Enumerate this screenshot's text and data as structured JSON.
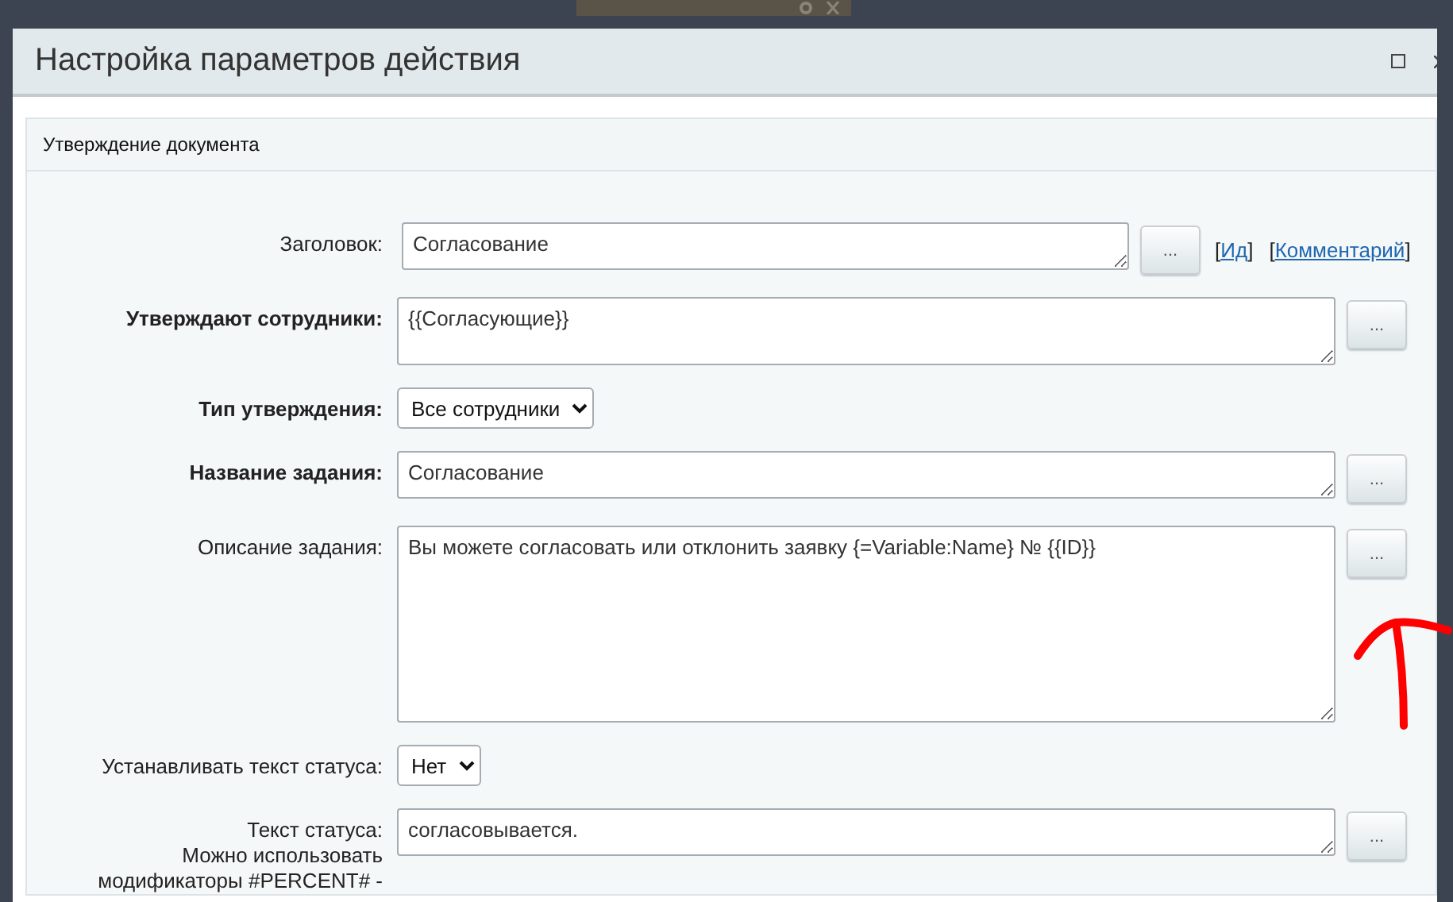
{
  "dialog": {
    "title": "Настройка параметров действия"
  },
  "section": {
    "title": "Утверждение документа"
  },
  "fields": [
    {
      "kind": "input",
      "label": "Заголовок:",
      "required": false,
      "value": "Согласование",
      "button": "...",
      "links": [
        {
          "before": "[",
          "text": "Ид",
          "after": "]"
        },
        {
          "before": "[",
          "text": "Комментарий",
          "after": "]"
        }
      ]
    },
    {
      "kind": "textarea",
      "label": "Утверждают сотрудники:",
      "required": true,
      "value": "{{Согласующие}}",
      "button": "..."
    },
    {
      "kind": "select",
      "label": "Тип утверждения:",
      "required": true,
      "value": "Все сотрудники"
    },
    {
      "kind": "line",
      "label": "Название задания:",
      "required": true,
      "value": "Согласование",
      "button": "..."
    },
    {
      "kind": "memo",
      "label": "Описание задания:",
      "required": false,
      "value": "Вы можете согласовать или отклонить заявку {=Variable:Name} № {{ID}}",
      "button": "..."
    },
    {
      "kind": "select",
      "label": "Устанавливать текст статуса:",
      "required": false,
      "value": "Нет"
    },
    {
      "kind": "line",
      "label": "Текст статуса:",
      "required": false,
      "value": "согласовывается.",
      "button": "...",
      "hint_lines": [
        "Можно использовать",
        "модификаторы #PERCENT# -"
      ]
    }
  ]
}
